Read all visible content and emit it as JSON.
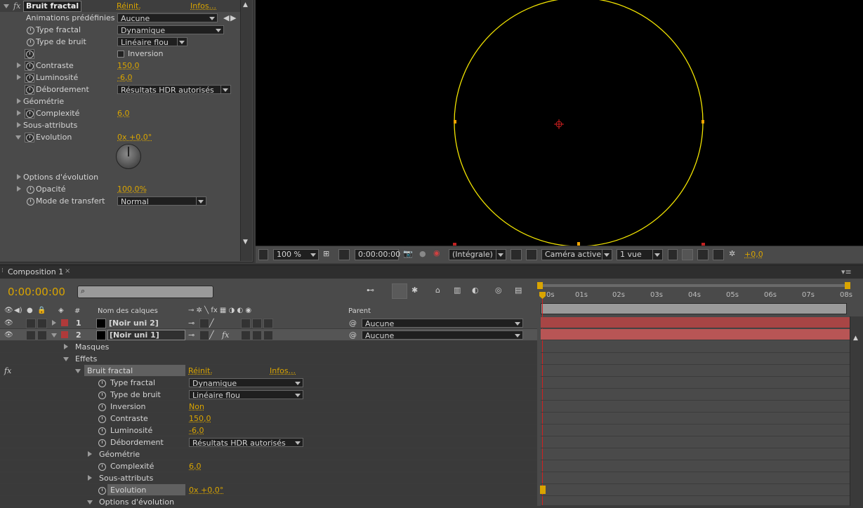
{
  "effect_controls": {
    "effect_name": "Bruit fractal",
    "reset": "Réinit.",
    "info": "Infos...",
    "rows": [
      {
        "label": "Animations prédéfinies :",
        "value": "Aucune"
      },
      {
        "label": "Type fractal",
        "value": "Dynamique"
      },
      {
        "label": "Type de bruit",
        "value": "Linéaire flou"
      },
      {
        "label": "",
        "value": "Inversion"
      },
      {
        "label": "Contraste",
        "value": "150,0"
      },
      {
        "label": "Luminosité",
        "value": "-6,0"
      },
      {
        "label": "Débordement",
        "value": "Résultats HDR autorisés"
      },
      {
        "label": "Géométrie",
        "value": ""
      },
      {
        "label": "Complexité",
        "value": "6,0"
      },
      {
        "label": "Sous-attributs",
        "value": ""
      },
      {
        "label": "Evolution",
        "value": "0x +0,0°"
      },
      {
        "label": "Options d'évolution",
        "value": ""
      },
      {
        "label": "Opacité",
        "value": "100,0%"
      },
      {
        "label": "Mode de transfert",
        "value": "Normal"
      }
    ]
  },
  "viewer": {
    "zoom": "100 %",
    "timecode": "0:00:00:00",
    "resolution": "(Intégrale)",
    "camera": "Caméra active",
    "views": "1 vue",
    "exposure": "+0,0"
  },
  "composition": {
    "tab": "Composition 1",
    "timecode": "0:00:00:00",
    "col_name": "Nom des calques",
    "col_hash": "#",
    "col_parent": "Parent",
    "ruler": [
      "0s",
      "01s",
      "02s",
      "03s",
      "04s",
      "05s",
      "06s",
      "07s",
      "08s"
    ],
    "layers": [
      {
        "num": "1",
        "name": "[Noir uni 2]",
        "parent": "Aucune"
      },
      {
        "num": "2",
        "name": "[Noir uni 1]",
        "parent": "Aucune"
      }
    ],
    "masks": "Masques",
    "effects": "Effets",
    "effect_name": "Bruit fractal",
    "reset": "Réinit.",
    "info": "Infos...",
    "props": [
      {
        "label": "Type fractal",
        "value": "Dynamique"
      },
      {
        "label": "Type de bruit",
        "value": "Linéaire flou"
      },
      {
        "label": "Inversion",
        "value": "Non"
      },
      {
        "label": "Contraste",
        "value": "150,0"
      },
      {
        "label": "Luminosité",
        "value": "-6,0"
      },
      {
        "label": "Débordement",
        "value": "Résultats HDR autorisés"
      },
      {
        "label": "Géométrie",
        "value": ""
      },
      {
        "label": "Complexité",
        "value": "6,0"
      },
      {
        "label": "Sous-attributs",
        "value": ""
      },
      {
        "label": "Evolution",
        "value": "0x +0,0°"
      },
      {
        "label": "Options d'évolution",
        "value": ""
      }
    ]
  },
  "colors": {
    "accent": "#d9a400",
    "circle": "#f2e400",
    "layer_label": "#b03a3a",
    "layer_bar": "#a84545"
  },
  "icons": [
    "fx-icon",
    "stopwatch-icon",
    "eye-icon",
    "camera-icon",
    "search-icon",
    "lock-icon"
  ]
}
